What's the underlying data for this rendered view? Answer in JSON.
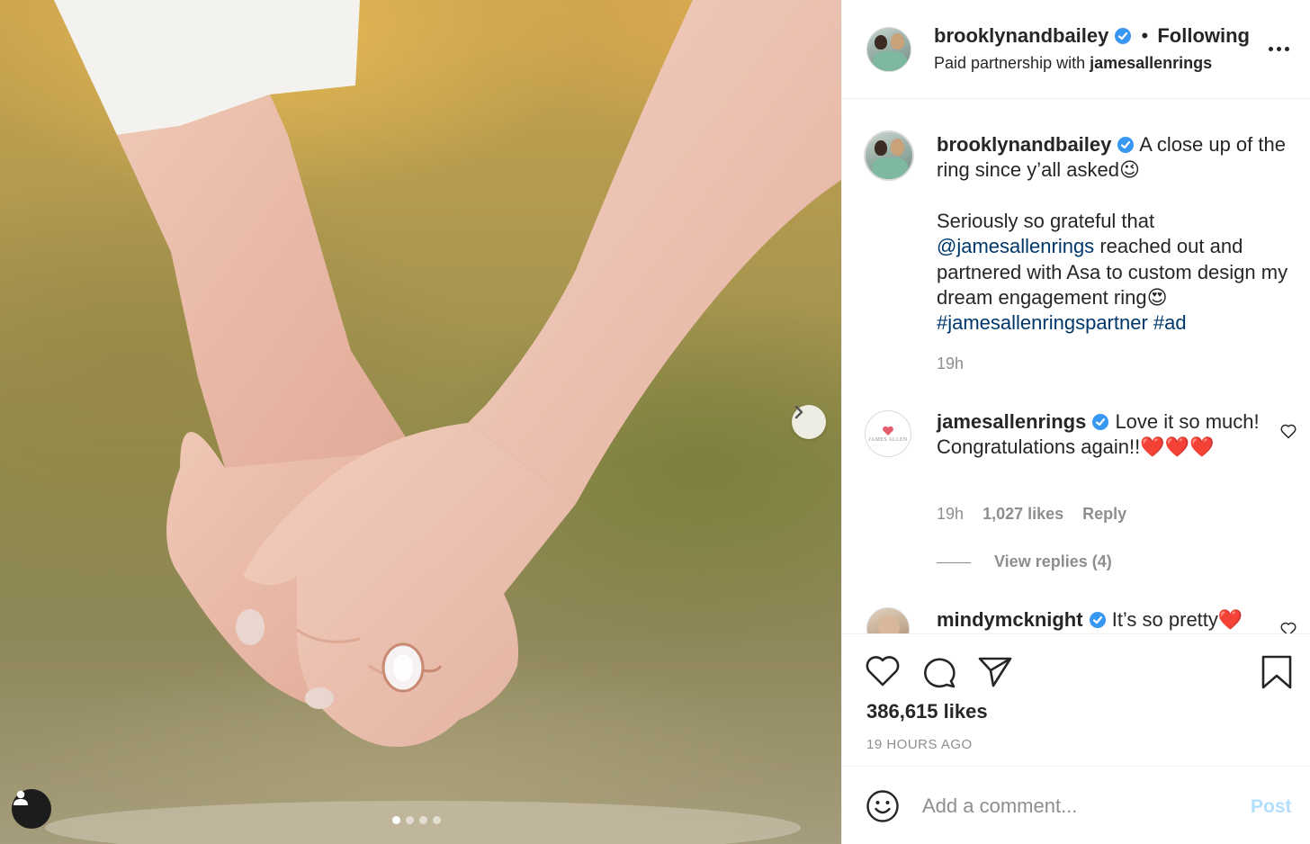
{
  "post": {
    "author": "brooklynandbailey",
    "following_label": "Following",
    "separator": "•",
    "paid_partnership_prefix": "Paid partnership with",
    "partner": "jamesallenrings"
  },
  "caption": {
    "username": "brooklynandbailey",
    "line1": "A close up of the ring since y’all asked😉",
    "para_start": "Seriously so grateful that",
    "mention": "@jamesallenrings",
    "para_mid": "reached out and partnered with Asa to custom design my dream engagement ring😍",
    "hashtag1": "#jamesallenringspartner",
    "hashtag2": "#ad",
    "time": "19h"
  },
  "comments": [
    {
      "username": "jamesallenrings",
      "text": "Love it so much! Congratulations again!!❤️❤️❤️",
      "time": "19h",
      "likes": "1,027 likes",
      "reply_label": "Reply",
      "view_replies": "View replies (4)",
      "avatar_text": "JAMES ALLEN"
    },
    {
      "username": "mindymcknight",
      "text": "It’s so pretty❤️"
    }
  ],
  "actions": {
    "likes": "386,615 likes",
    "time_ago": "19 HOURS AGO"
  },
  "add_comment": {
    "placeholder": "Add a comment...",
    "post_label": "Post"
  },
  "carousel": {
    "count": 4,
    "active_index": 0
  },
  "colors": {
    "verified_blue": "#3897f0",
    "link_blue": "#00376b",
    "muted": "#8e8e8e",
    "post_disabled": "#b2dffc"
  }
}
